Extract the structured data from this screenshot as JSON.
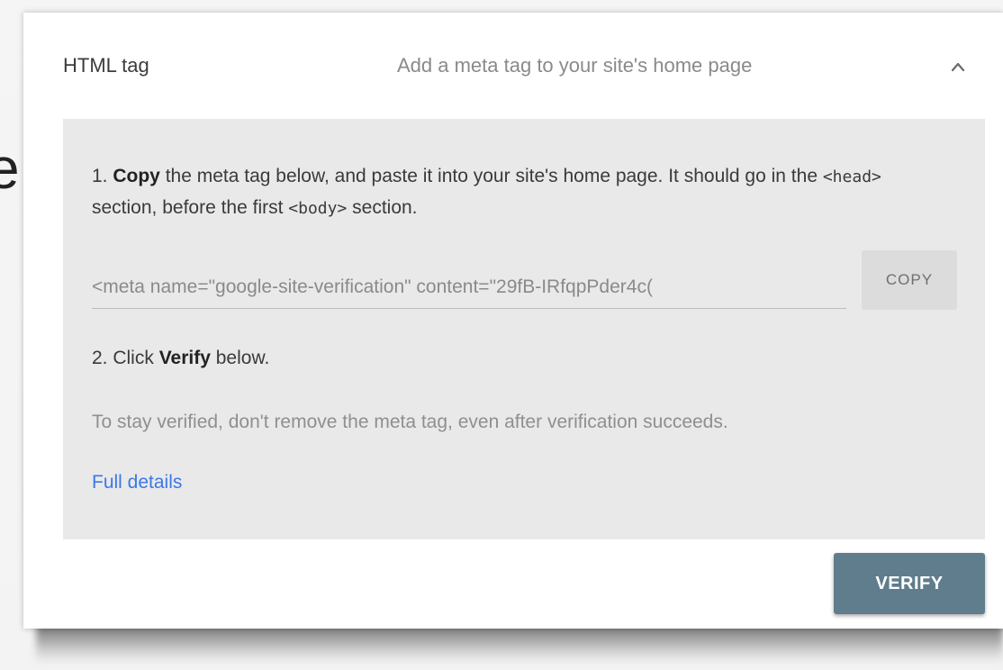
{
  "background": {
    "edge_glyph": "e"
  },
  "card": {
    "title": "HTML tag",
    "description": "Add a meta tag to your site's home page",
    "collapse_icon": "chevron-up-icon"
  },
  "instructions": {
    "step1_prefix": "1. ",
    "step1_bold": "Copy",
    "step1_text_a": " the meta tag below, and paste it into your site's home page. It should go in the ",
    "step1_code_head": "<head>",
    "step1_text_b": " section, before the first ",
    "step1_code_body": "<body>",
    "step1_text_c": " section.",
    "meta_tag_value": "<meta name=\"google-site-verification\" content=\"29fB-IRfqpPder4c(",
    "copy_label": "COPY",
    "step2_prefix": "2. Click ",
    "step2_bold": "Verify",
    "step2_suffix": " below.",
    "note": "To stay verified, don't remove the meta tag, even after verification succeeds.",
    "details_link": "Full details"
  },
  "actions": {
    "verify_label": "VERIFY"
  },
  "colors": {
    "panel_bg": "#e9e9e9",
    "link": "#3b78e7",
    "verify_bg": "#5f7d8c"
  }
}
